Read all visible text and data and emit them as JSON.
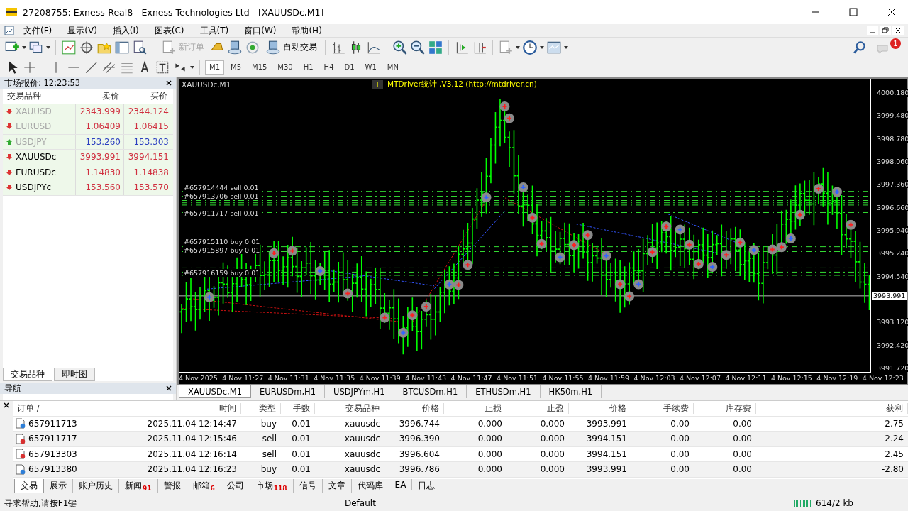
{
  "window": {
    "title": "27208755: Exness-Real8 - Exness Technologies Ltd - [XAUUSDc,M1]"
  },
  "menu": [
    "文件(F)",
    "显示(V)",
    "插入(I)",
    "图表(C)",
    "工具(T)",
    "窗口(W)",
    "帮助(H)"
  ],
  "toolbar": {
    "new_order": {
      "label": "新订单",
      "disabled": true
    },
    "auto_trading": {
      "label": "自动交易"
    },
    "notification_count": "1"
  },
  "timeframes": [
    {
      "label": "M1",
      "selected": true
    },
    {
      "label": "M5",
      "selected": false
    },
    {
      "label": "M15",
      "selected": false
    },
    {
      "label": "M30",
      "selected": false
    },
    {
      "label": "H1",
      "selected": false
    },
    {
      "label": "H4",
      "selected": false
    },
    {
      "label": "D1",
      "selected": false
    },
    {
      "label": "W1",
      "selected": false
    },
    {
      "label": "MN",
      "selected": false
    }
  ],
  "market_watch": {
    "title": "市场报价: 12:23:53",
    "columns": [
      "交易品种",
      "卖价",
      "买价"
    ],
    "rows": [
      {
        "symbol": "XAUUSD",
        "bid": "2343.999",
        "ask": "2344.124",
        "rising": false,
        "inactive": true
      },
      {
        "symbol": "EURUSD",
        "bid": "1.06409",
        "ask": "1.06415",
        "rising": false,
        "inactive": true
      },
      {
        "symbol": "USDJPY",
        "bid": "153.260",
        "ask": "153.303",
        "rising": true,
        "inactive": true
      },
      {
        "symbol": "XAUUSDc",
        "bid": "3993.991",
        "ask": "3994.151",
        "rising": false,
        "inactive": false
      },
      {
        "symbol": "EURUSDc",
        "bid": "1.14830",
        "ask": "1.14838",
        "rising": false,
        "inactive": false
      },
      {
        "symbol": "USDJPYc",
        "bid": "153.560",
        "ask": "153.570",
        "rising": false,
        "inactive": false
      }
    ],
    "tabs": [
      {
        "label": "交易品种",
        "selected": true
      },
      {
        "label": "即时图",
        "selected": false
      }
    ]
  },
  "navigator": {
    "title": "导航"
  },
  "chart": {
    "symbol_label": "XAUUSDc,M1",
    "indicator_button": "+",
    "indicator_label": "MTDriver统计 ,V3.12 (http://mtdriver.cn)",
    "order_labels": [
      "#657914444 sell 0.01",
      "#657913706 sell 0.01",
      "#657911717 sell 0.01",
      "#657915110 buy 0.01",
      "#657915897 buy 0.01",
      "#657916159 buy 0.01"
    ],
    "price_labels": [
      "4000.180",
      "3999.480",
      "3998.780",
      "3998.060",
      "3997.360",
      "3996.660",
      "3995.940",
      "3995.240",
      "3994.540",
      "3993.120",
      "3992.420",
      "3991.720"
    ],
    "current_price": "3993.991",
    "time_labels": [
      "4 Nov 2025",
      "4 Nov 11:27",
      "4 Nov 11:31",
      "4 Nov 11:35",
      "4 Nov 11:39",
      "4 Nov 11:43",
      "4 Nov 11:47",
      "4 Nov 11:51",
      "4 Nov 11:55",
      "4 Nov 11:59",
      "4 Nov 12:03",
      "4 Nov 12:07",
      "4 Nov 12:11",
      "4 Nov 12:15",
      "4 Nov 12:19",
      "4 Nov 12:23"
    ]
  },
  "chart_tabs": [
    {
      "label": "XAUUSDc,M1",
      "selected": true
    },
    {
      "label": "EURUSDm,H1",
      "selected": false
    },
    {
      "label": "USDJPYm,H1",
      "selected": false
    },
    {
      "label": "BTCUSDm,H1",
      "selected": false
    },
    {
      "label": "ETHUSDm,H1",
      "selected": false
    },
    {
      "label": "HK50m,H1",
      "selected": false
    }
  ],
  "terminal": {
    "columns": [
      "订单 /",
      "时间",
      "类型",
      "手数",
      "交易品种",
      "价格",
      "止损",
      "止盈",
      "价格",
      "手续费",
      "库存费",
      "获利"
    ],
    "rows": [
      {
        "kind": "buy",
        "cells": [
          "657911713",
          "2025.11.04 12:14:47",
          "buy",
          "0.01",
          "xauusdc",
          "3996.744",
          "0.000",
          "0.000",
          "3993.991",
          "0.00",
          "0.00",
          "-2.75"
        ]
      },
      {
        "kind": "sell",
        "cells": [
          "657911717",
          "2025.11.04 12:15:46",
          "sell",
          "0.01",
          "xauusdc",
          "3996.390",
          "0.000",
          "0.000",
          "3994.151",
          "0.00",
          "0.00",
          "2.24"
        ]
      },
      {
        "kind": "sell",
        "cells": [
          "657913303",
          "2025.11.04 12:16:14",
          "sell",
          "0.01",
          "xauusdc",
          "3996.604",
          "0.000",
          "0.000",
          "3994.151",
          "0.00",
          "0.00",
          "2.45"
        ]
      },
      {
        "kind": "buy",
        "cells": [
          "657913380",
          "2025.11.04 12:16:23",
          "buy",
          "0.01",
          "xauusdc",
          "3996.786",
          "0.000",
          "0.000",
          "3993.991",
          "0.00",
          "0.00",
          "-2.80"
        ]
      }
    ],
    "tabs": [
      {
        "label": "交易",
        "selected": true
      },
      {
        "label": "展示",
        "selected": false
      },
      {
        "label": "账户历史",
        "selected": false
      },
      {
        "label": "新闻",
        "count": "91",
        "selected": false
      },
      {
        "label": "警报",
        "selected": false
      },
      {
        "label": "邮箱",
        "count": "6",
        "selected": false
      },
      {
        "label": "公司",
        "selected": false
      },
      {
        "label": "市场",
        "count": "118",
        "selected": false
      },
      {
        "label": "信号",
        "selected": false
      },
      {
        "label": "文章",
        "selected": false
      },
      {
        "label": "代码库",
        "selected": false
      },
      {
        "label": "EA",
        "selected": false
      },
      {
        "label": "日志",
        "selected": false
      }
    ]
  },
  "status_bar": {
    "help": "寻求帮助,请按F1键",
    "profile": "Default",
    "traffic": "614/2 kb"
  }
}
